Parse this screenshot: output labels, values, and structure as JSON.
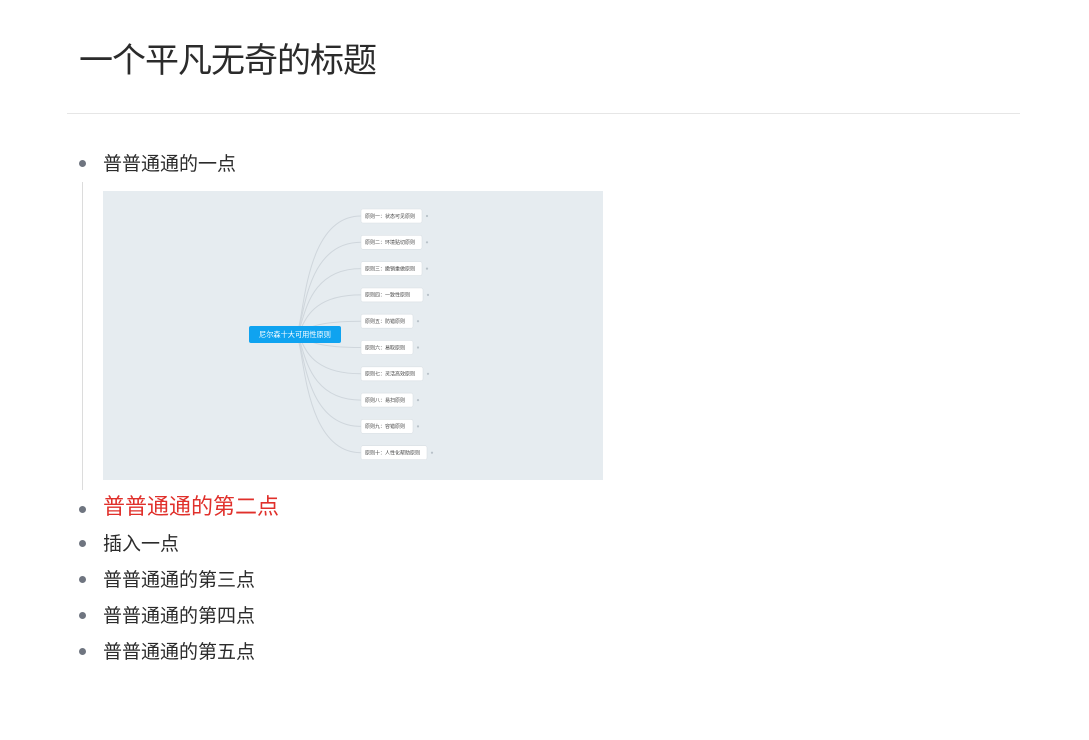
{
  "document": {
    "title": "一个平凡无奇的标题"
  },
  "list": {
    "items": [
      {
        "label": "普普通通的一点",
        "highlight": false
      },
      {
        "label": "普普通通的第二点",
        "highlight": true
      },
      {
        "label": "插入一点",
        "highlight": false
      },
      {
        "label": "普普通通的第三点",
        "highlight": false
      },
      {
        "label": "普普通通的第四点",
        "highlight": false
      },
      {
        "label": "普普通通的第五点",
        "highlight": false
      }
    ]
  },
  "mindmap": {
    "center": "尼尔森十大可用性原则",
    "branches": [
      "原则一：状态可见原则",
      "原则二：环境贴切原则",
      "原则三：撤销重做原则",
      "原则四：一致性原则",
      "原则五：防错原则",
      "原则六：易取原则",
      "原则七：灵活高效原则",
      "原则八：易扫原则",
      "原则九：容错原则",
      "原则十：人性化帮助原则"
    ],
    "colors": {
      "background": "#e6ecf0",
      "center_fill": "#0fa3f0",
      "center_text": "#ffffff",
      "branch_fill": "#ffffff",
      "line": "#cfd6dc"
    }
  },
  "colors": {
    "highlight": "#e0302b",
    "bullet": "#6f7580",
    "text": "#2b2b2b"
  }
}
